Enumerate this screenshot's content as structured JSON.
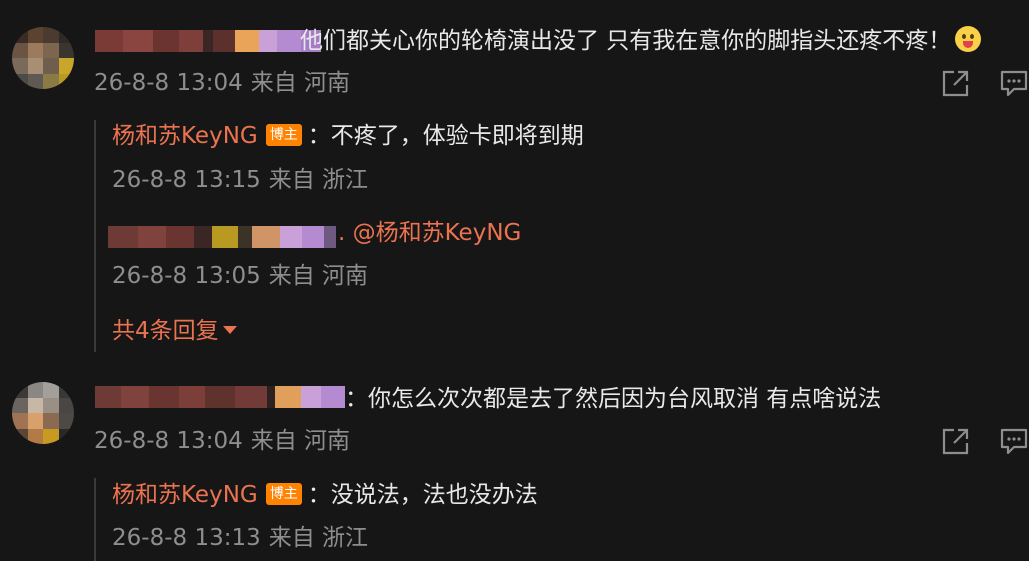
{
  "comments": [
    {
      "text": "他们都关心你的轮椅演出没了 只有我在意你的脚指头还疼不疼！",
      "time": "26-8-8 13:04",
      "location": "来自 河南",
      "emoji": "grinning-tongue-emoji",
      "replies": [
        {
          "author": "杨和苏KeyNG",
          "badge": "博主",
          "text": "：不疼了，体验卡即将到期",
          "time": "26-8-8 13:15",
          "location": "来自 浙江"
        },
        {
          "mention": ". @杨和苏KeyNG",
          "time": "26-8-8 13:05",
          "location": "来自 河南"
        }
      ],
      "more_label": "共4条回复"
    },
    {
      "text": "：你怎么次次都是去了然后因为台风取消 有点啥说法",
      "time": "26-8-8 13:04",
      "location": "来自 河南",
      "replies": [
        {
          "author": "杨和苏KeyNG",
          "badge": "博主",
          "text": "：没说法，法也没办法",
          "time": "26-8-8 13:13",
          "location": "来自 浙江"
        }
      ]
    }
  ],
  "icons": {
    "share": "share-icon",
    "comment": "comment-icon"
  },
  "colors": {
    "background": "#161617",
    "accent": "#eb7350",
    "badge": "#ff8200",
    "meta": "#8e8e8e"
  }
}
